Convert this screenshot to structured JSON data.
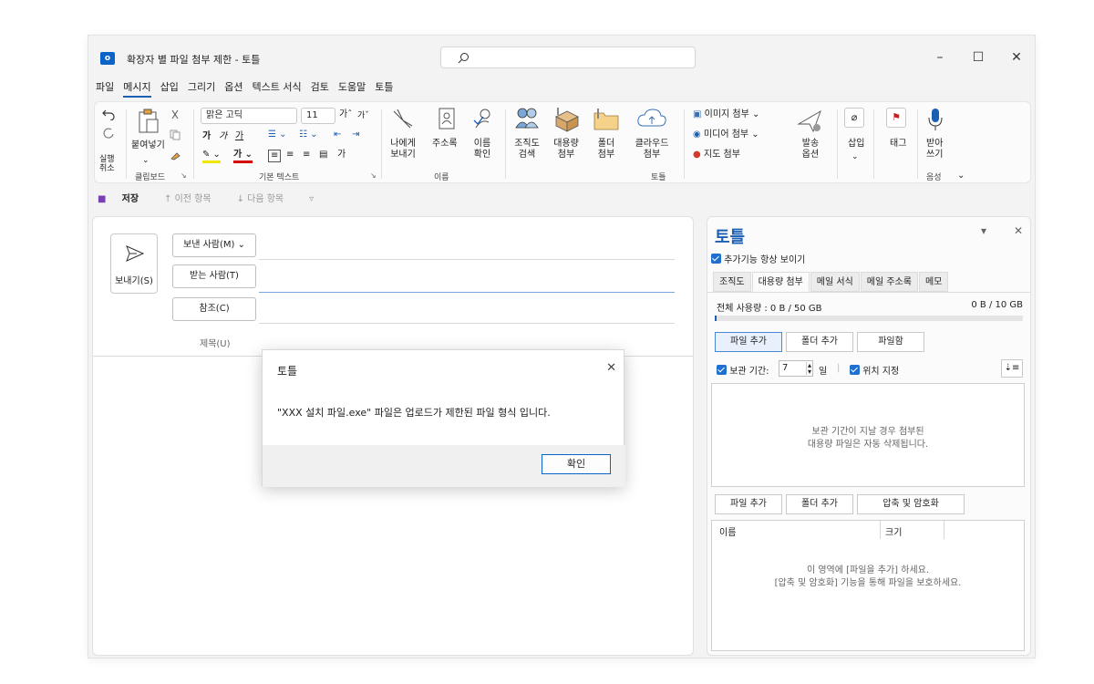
{
  "window": {
    "title": "확장자 별 파일 첨부 제한 - 토틀",
    "app_icon": "outlook-icon"
  },
  "menu": [
    "파일",
    "메시지",
    "삽입",
    "그리기",
    "옵션",
    "텍스트 서식",
    "검토",
    "도움말",
    "토틀"
  ],
  "ribbon": {
    "undo_label": "실행\n취소",
    "clipboard": {
      "paste": "붙여넣기",
      "group": "클립보드"
    },
    "font": {
      "name": "맑은 고딕",
      "size": "11",
      "group": "기본 텍스트"
    },
    "names": {
      "send_to_me": "나에게\n보내기",
      "address_book": "주소록",
      "check_names": "이름\n확인",
      "group": "이름"
    },
    "totle": {
      "org_search": "조직도\n검색",
      "large_attach": "대용량\n첨부",
      "folder_attach": "폴더\n첨부",
      "cloud_attach": "클라우드\n첨부",
      "group": "토틀"
    },
    "attach": {
      "image": "이미지 첨부",
      "media": "미디어 첨부",
      "map": "지도 첨부"
    },
    "send_options": "발송\n옵션",
    "insert": "삽입",
    "tag": "태그",
    "dictate": "받아\n쓰기",
    "voice_group": "음성"
  },
  "qat": {
    "save": "저장",
    "prev": "이전 항목",
    "next": "다음 항목"
  },
  "compose": {
    "send": "보내기(S)",
    "from": "보낸 사람(M)",
    "to": "받는 사람(T)",
    "cc": "참조(C)",
    "subject": "제목(U)"
  },
  "dialog": {
    "title": "토틀",
    "message": "\"XXX 설치 파일.exe\" 파일은 업로드가 제한된 파일 형식 입니다.",
    "ok": "확인"
  },
  "panel": {
    "title": "토틀",
    "always_show": "추가기능 항상 보이기",
    "tabs": [
      "조직도",
      "대용량 첨부",
      "메일 서식",
      "메일 주소록",
      "메모"
    ],
    "usage_label": "전체 사용량 : 0 B / 50 GB",
    "usage_right": "0 B / 10 GB",
    "usage_fraction": 0.004,
    "add_file": "파일 추가",
    "add_folder": "폴더 추가",
    "file_box": "파일함",
    "retention_label": "보관 기간:",
    "retention_value": "7",
    "retention_unit": "일",
    "location": "위치 지정",
    "retention_msg_1": "보관 기간이 지날 경우 첨부된",
    "retention_msg_2": "대용량 파일은 자동 삭제됩니다.",
    "add_file_2": "파일 추가",
    "add_folder_2": "폴더 추가",
    "compress": "압축 및 암호화",
    "col_name": "이름",
    "col_size": "크기",
    "drop_msg_1": "이 영역에 [파일을 추가] 하세요.",
    "drop_msg_2": "[압축 및 암호화] 기능을 통해 파일을 보호하세요."
  }
}
